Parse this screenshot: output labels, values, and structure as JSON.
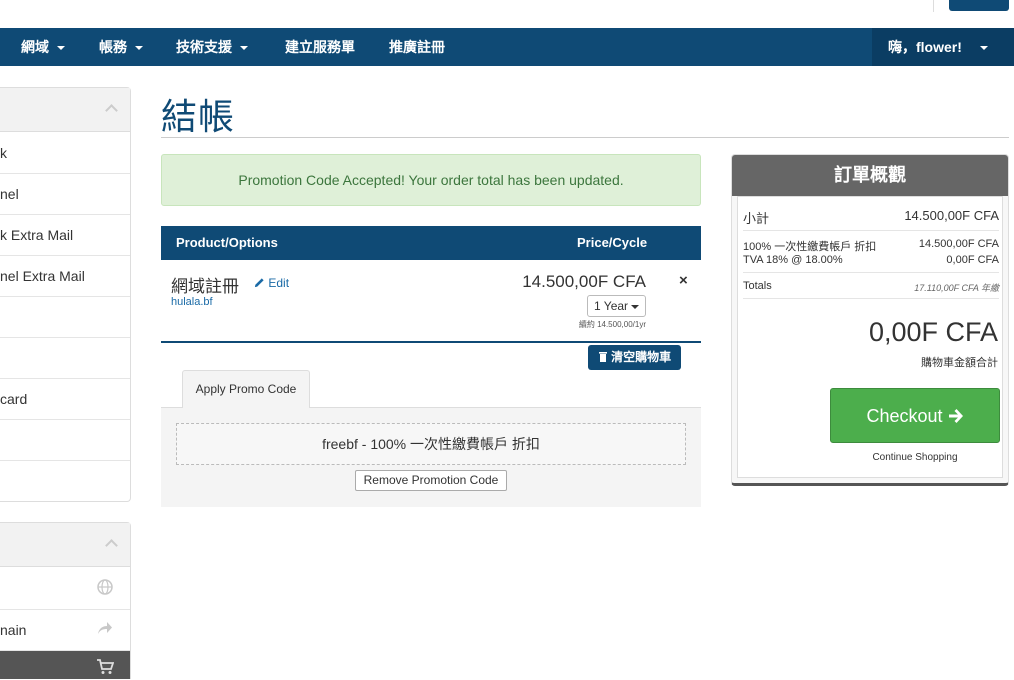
{
  "nav": {
    "items": [
      {
        "label": "網域",
        "has_caret": true
      },
      {
        "label": "帳務",
        "has_caret": true
      },
      {
        "label": "技術支援",
        "has_caret": true
      },
      {
        "label": "建立服務單",
        "has_caret": false
      },
      {
        "label": "推廣註冊",
        "has_caret": false
      }
    ],
    "user_greeting": "嗨，flower!"
  },
  "sidebar": {
    "items": [
      "k",
      "nel",
      "k Extra Mail",
      "nel Extra Mail",
      "",
      "",
      "card",
      "",
      ""
    ],
    "actions": [
      {
        "label": "",
        "icon": "globe-icon"
      },
      {
        "label": "nain",
        "icon": "share-icon"
      },
      {
        "label": "",
        "icon": "cart-icon"
      }
    ]
  },
  "page": {
    "title": "結帳",
    "alert": "Promotion Code Accepted! Your order total has been updated."
  },
  "cart": {
    "col_product": "Product/Options",
    "col_price": "Price/Cycle",
    "item": {
      "name": "網域註冊",
      "edit_label": "Edit",
      "domain": "hulala.bf",
      "price": "14.500,00F CFA",
      "cycle": "1 Year",
      "renewal": "續約 14.500,00/1yr"
    },
    "empty_cart_label": "清空購物車"
  },
  "promo": {
    "tab_label": "Apply Promo Code",
    "applied_code": "freebf - 100% 一次性繳費帳戶 折扣",
    "remove_label": "Remove Promotion Code"
  },
  "summary": {
    "title": "訂單概觀",
    "subtotal_label": "小計",
    "subtotal_value": "14.500,00F CFA",
    "discount_label": "100% 一次性繳費帳戶 折扣",
    "discount_value": "14.500,00F CFA",
    "tax_label": "TVA 18% @ 18.00%",
    "tax_value": "0,00F CFA",
    "totals_label": "Totals",
    "totals_value": "17.110,00F CFA 年繳",
    "total_due": "0,00F CFA",
    "total_due_label": "購物車金額合計",
    "checkout_label": "Checkout",
    "continue_label": "Continue Shopping"
  },
  "colors": {
    "brand": "#0f4a75",
    "success": "#4cae4c",
    "alert_bg": "#dff0d8"
  }
}
